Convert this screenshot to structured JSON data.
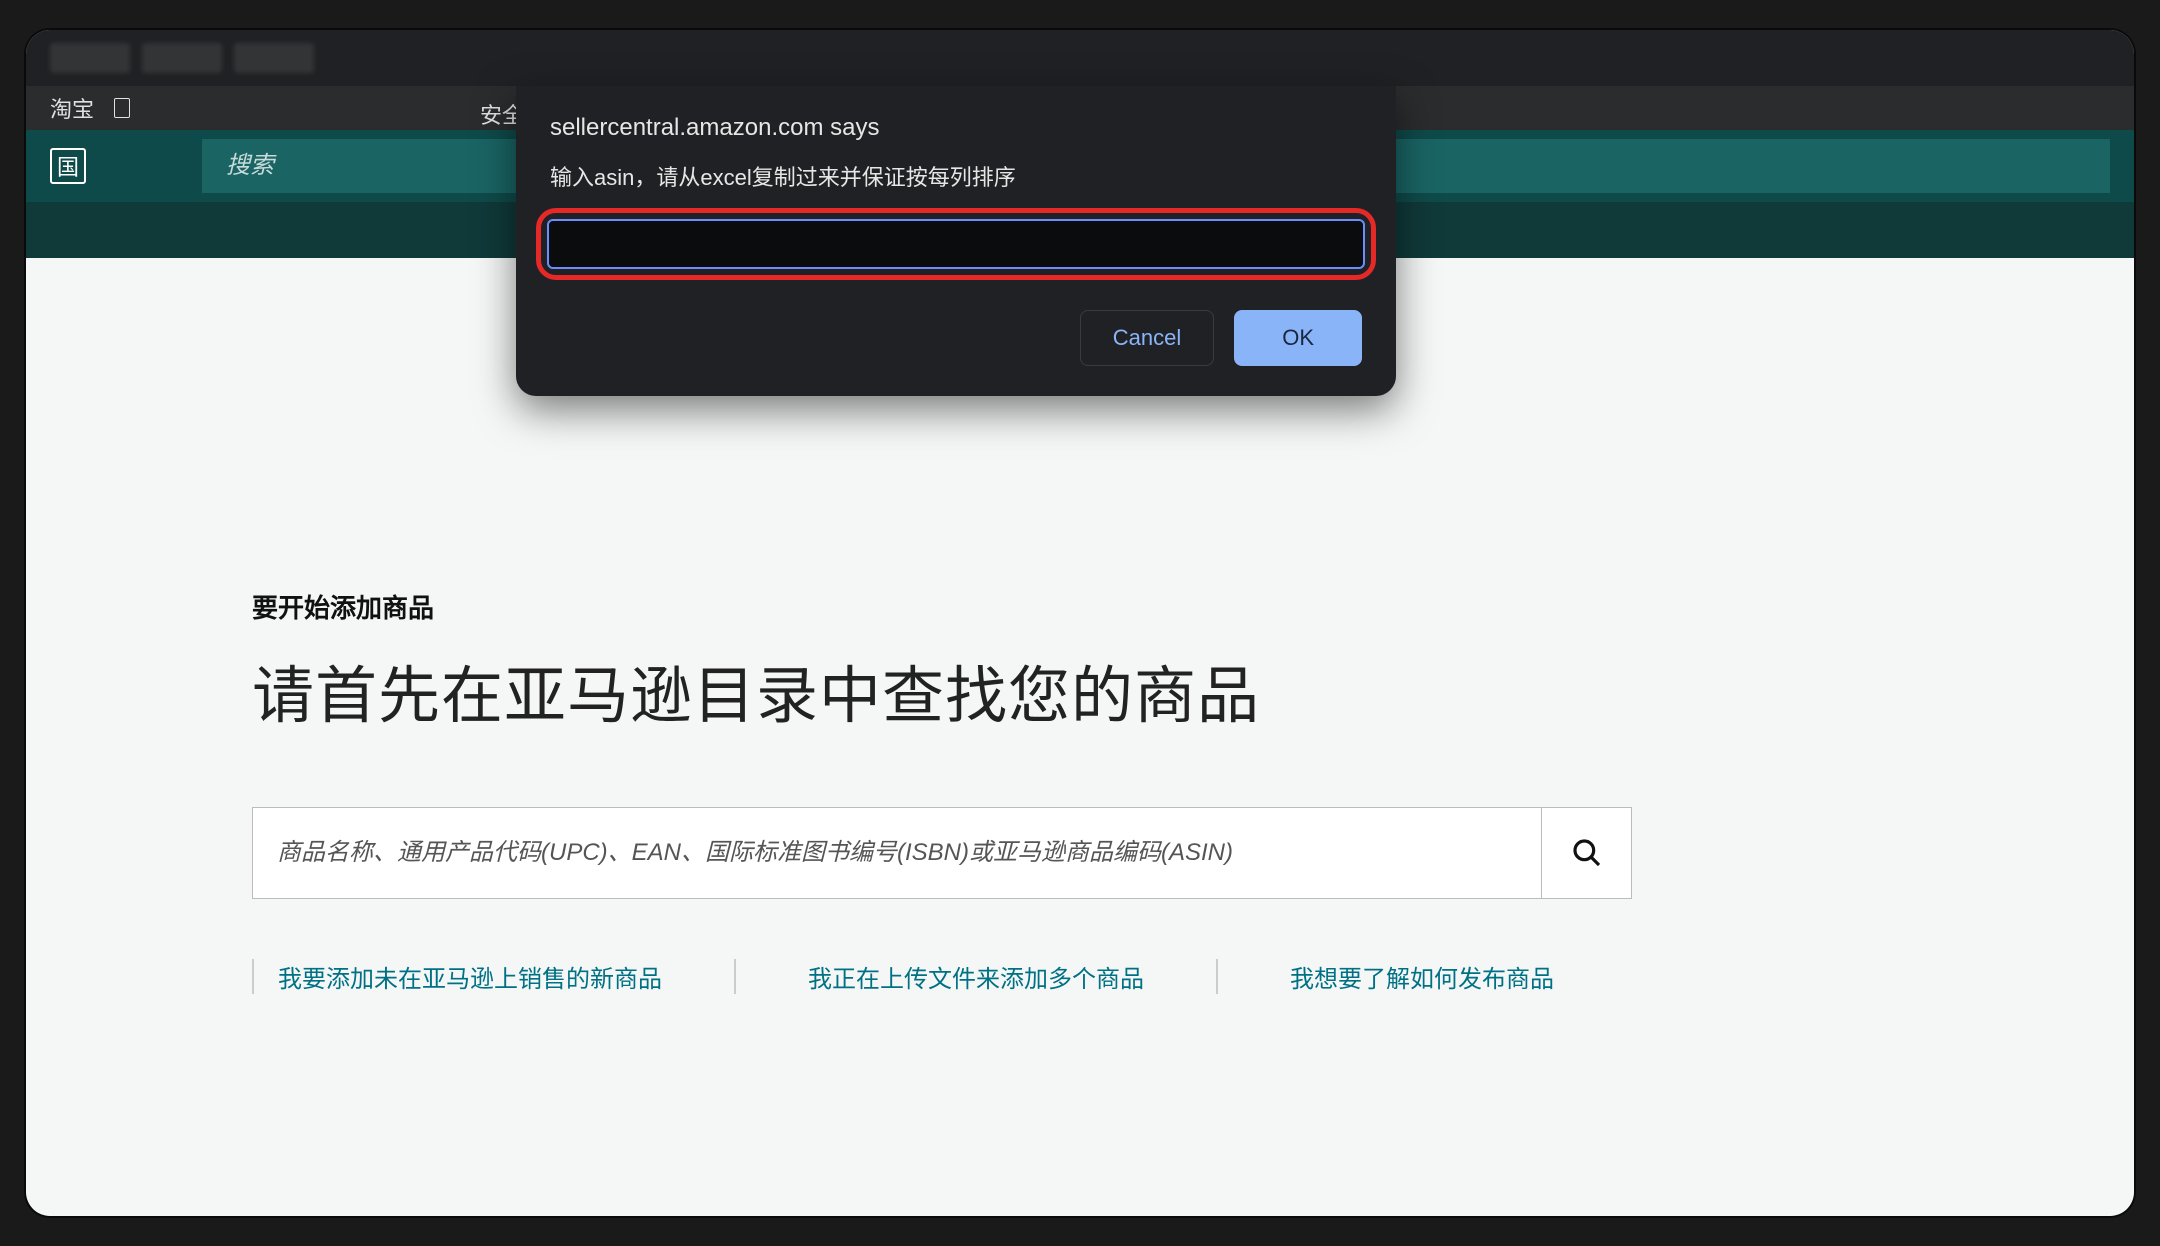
{
  "bookmark_bar": {
    "taobao_label": "淘宝",
    "safe_label": "安全"
  },
  "header": {
    "country_label": "国",
    "search_placeholder": "搜索"
  },
  "main": {
    "subtitle": "要开始添加商品",
    "title": "请首先在亚马逊目录中查找您的商品",
    "product_search_placeholder": "商品名称、通用产品代码(UPC)、EAN、国际标准图书编号(ISBN)或亚马逊商品编码(ASIN)",
    "links": [
      "我要添加未在亚马逊上销售的新商品",
      "我正在上传文件来添加多个商品",
      "我想要了解如何发布商品"
    ]
  },
  "dialog": {
    "origin": "sellercentral.amazon.com says",
    "message": "输入asin，请从excel复制过来并保证按每列排序",
    "input_value": "",
    "cancel_label": "Cancel",
    "ok_label": "OK"
  }
}
